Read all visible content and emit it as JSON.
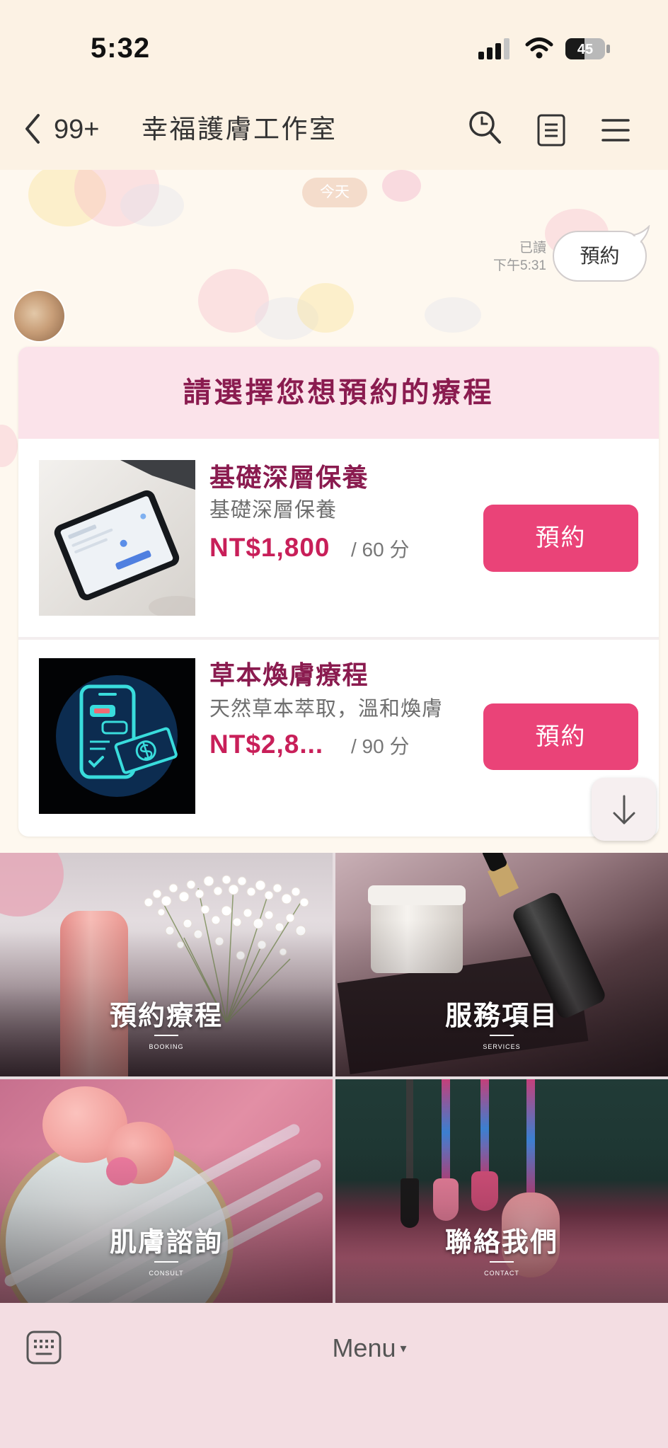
{
  "status_bar": {
    "time": "5:32",
    "battery_level": "45"
  },
  "header": {
    "back_count": "99+",
    "title": "幸福護膚工作室"
  },
  "chat": {
    "date_label": "今天",
    "outgoing_message": {
      "read_status": "已讀",
      "time": "下午5:31",
      "text": "預約"
    }
  },
  "booking_card": {
    "title": "請選擇您想預約的療程",
    "items": [
      {
        "name": "基礎深層保養",
        "description": "基礎深層保養",
        "price": "NT$1,800",
        "duration": "/ 60 分",
        "button_label": "預約"
      },
      {
        "name": "草本煥膚療程",
        "description": "天然草本萃取，溫和煥膚",
        "price": "NT$2,8...",
        "duration": "/ 90 分",
        "button_label": "預約"
      }
    ]
  },
  "rich_menu": {
    "tiles": [
      {
        "label": "預約療程",
        "sublabel": "BOOKING"
      },
      {
        "label": "服務項目",
        "sublabel": "SERVICES"
      },
      {
        "label": "肌膚諮詢",
        "sublabel": "CONSULT"
      },
      {
        "label": "聯絡我們",
        "sublabel": "CONTACT"
      }
    ]
  },
  "bottom_bar": {
    "menu_label": "Menu",
    "menu_caret": "▾"
  },
  "icons": {
    "back": "back-chevron-icon",
    "search": "search-icon",
    "note": "note-list-icon",
    "menu": "hamburger-menu-icon",
    "scroll_down": "arrow-down-icon",
    "keyboard": "keyboard-icon",
    "signal": "cellular-signal-icon",
    "wifi": "wifi-icon",
    "battery": "battery-icon"
  },
  "colors": {
    "header_bg": "#fcf2e4",
    "chat_bg": "#fef8ef",
    "card_header_bg": "#fbe3ea",
    "card_title": "#8a1b4f",
    "price": "#c81f59",
    "accent": "#ea4378",
    "bottom_bar_bg": "#f3dde2"
  }
}
